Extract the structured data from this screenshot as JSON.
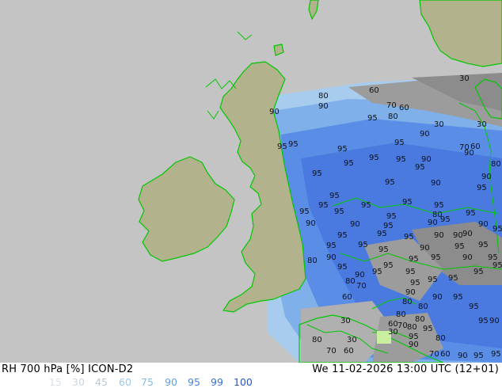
{
  "footer": {
    "title": "RH 700 hPa [%] ICON-D2",
    "timestamp": "We 11-02-2026 13:00 UTC (12+01)"
  },
  "legend": {
    "items": [
      {
        "label": "15",
        "color": "#d9e2ea"
      },
      {
        "label": "30",
        "color": "#c8d6e2"
      },
      {
        "label": "45",
        "color": "#b5c9d9"
      },
      {
        "label": "60",
        "color": "#9cc8ec"
      },
      {
        "label": "75",
        "color": "#7fbbea"
      },
      {
        "label": "90",
        "color": "#5ea2e2"
      },
      {
        "label": "95",
        "color": "#4a86dc"
      },
      {
        "label": "99",
        "color": "#3a6fd6"
      },
      {
        "label": "100",
        "color": "#2a55cc"
      }
    ]
  },
  "map": {
    "colors": {
      "background": "#c4c4c4",
      "land": "#b2b28c",
      "coast": "#00c800",
      "rh_light": "#a8ccee",
      "rh_mid": "#7fb0ea",
      "rh_high": "#5a8ee6",
      "rh_max": "#4a7ae0",
      "rh_grey": "#9c9c9c",
      "rh_darkgrey": "#8c8c8c"
    },
    "contour_labels": [
      "60",
      "70",
      "80",
      "90",
      "95",
      "30"
    ]
  }
}
